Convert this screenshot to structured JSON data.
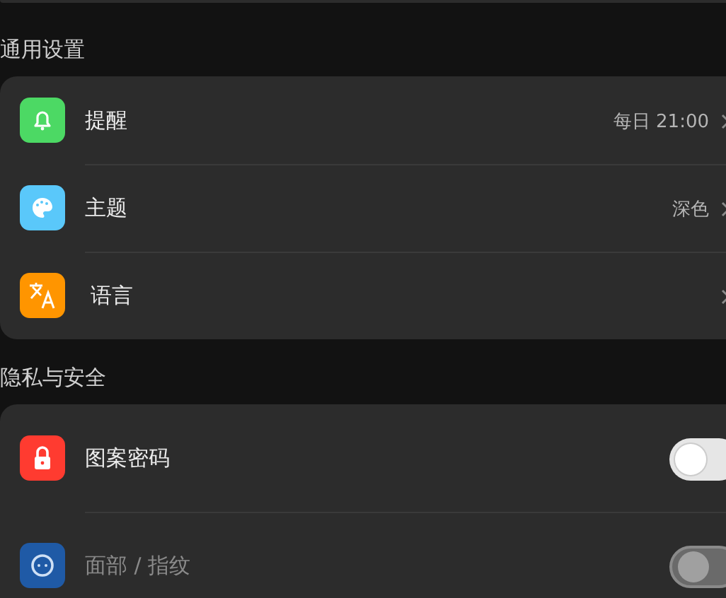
{
  "sections": [
    {
      "title": "通用设置",
      "items": [
        {
          "kind": "link",
          "label": "提醒",
          "value": "每日 21:00",
          "color": "#4cd964"
        },
        {
          "kind": "link",
          "label": "主题",
          "value": "深色",
          "color": "#5ac8fa"
        },
        {
          "kind": "link",
          "label": "语言",
          "color": "#ff9500"
        }
      ]
    },
    {
      "title": "隐私与安全",
      "items": [
        {
          "kind": "toggle",
          "label": "图案密码",
          "on": false,
          "disabled": false,
          "color": "#ff3b30"
        },
        {
          "kind": "toggle",
          "label": "面部 / 指纹",
          "on": false,
          "disabled": true,
          "color": "#1f5aa6"
        }
      ]
    }
  ]
}
